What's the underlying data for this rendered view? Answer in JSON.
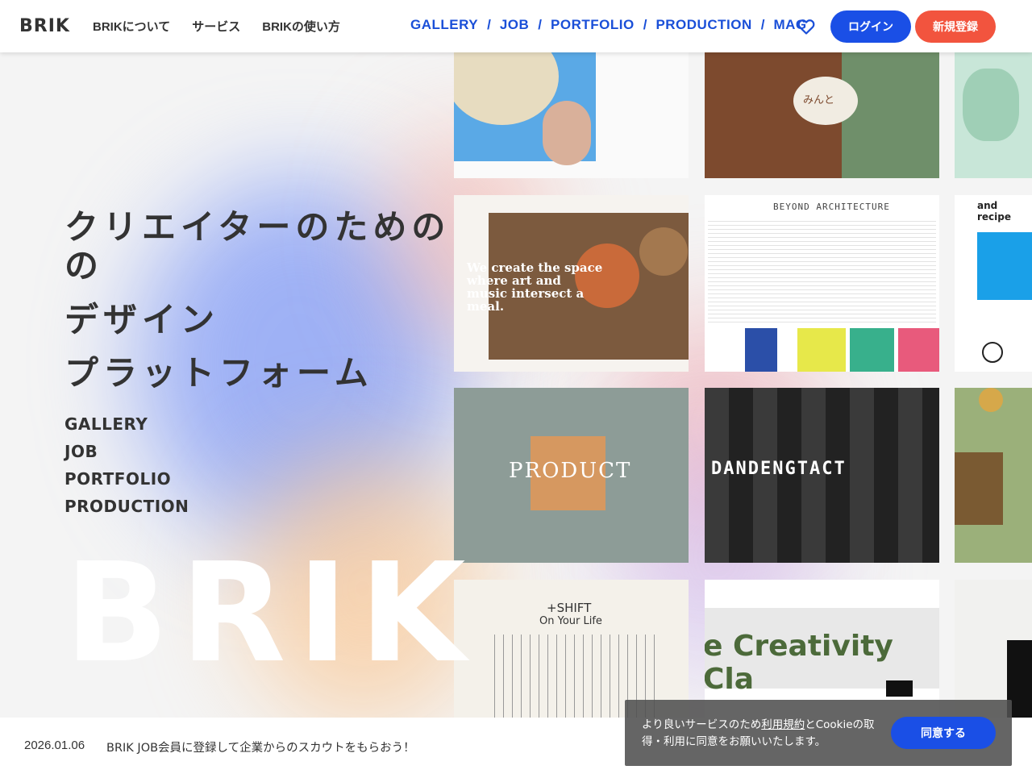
{
  "header": {
    "logo": "BRIK",
    "nav_left": [
      "BRIKについて",
      "サービス",
      "BRIKの使い方"
    ],
    "nav_right": [
      "GALLERY",
      "JOB",
      "PORTFOLIO",
      "PRODUCTION",
      "MAG"
    ],
    "separator": "/",
    "login_label": "ログイン",
    "signup_label": "新規登録"
  },
  "hero": {
    "title_lines": [
      "クリエイターのための",
      "の",
      "デザイン",
      "プラットフォーム"
    ],
    "links": [
      "GALLERY",
      "JOB",
      "PORTFOLIO",
      "PRODUCTION"
    ],
    "big_logo": "BRIK"
  },
  "gallery": {
    "t2_caption": "みんと",
    "t4_caption": "We create the space where art and music intersect a meal.",
    "t5_caption": "BEYOND ARCHITECTURE",
    "t6_caption": "and recipe",
    "t7_caption": "PRODUCT",
    "t8_caption": "DANDENGTACT",
    "t10_caption_1": "+SHIFT",
    "t10_caption_2": "On Your Life",
    "t11_caption": "e Creativity Cla"
  },
  "news": {
    "date": "2026.01.06",
    "text": "BRIK JOB会員に登録して企業からのスカウトをもらおう！"
  },
  "cookie": {
    "text_1": "より良いサービスのため",
    "link": "利用規約",
    "text_2": "とCookieの取得・利用に同意をお願いいたします。",
    "agree_label": "同意する"
  },
  "colors": {
    "accent_blue": "#1a4fe6",
    "signup_red": "#f2543e",
    "nav_blue": "#1a4fd8"
  }
}
